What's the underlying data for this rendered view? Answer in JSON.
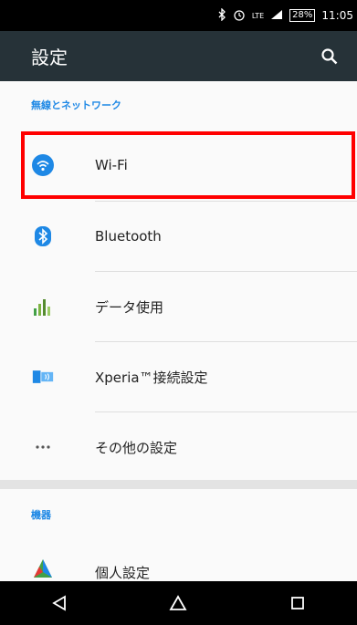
{
  "status_bar": {
    "icons": [
      "bluetooth-icon",
      "alarm-icon",
      "lte-signal-icon",
      "battery-icon"
    ],
    "lte": "LTE",
    "battery": "28%",
    "time": "11:05"
  },
  "app_bar": {
    "title": "設定",
    "icon": "search-icon"
  },
  "sections": [
    {
      "header": "無線とネットワーク",
      "items": [
        {
          "label": "Wi-Fi",
          "icon": "wifi-icon"
        },
        {
          "label": "Bluetooth",
          "icon": "bluetooth-icon"
        },
        {
          "label": "データ使用",
          "icon": "data-usage-icon"
        },
        {
          "label": "Xperia™接続設定",
          "icon": "xperia-connectivity-icon"
        },
        {
          "label": "その他の設定",
          "icon": "more-icon"
        }
      ]
    },
    {
      "header": "機器",
      "items": [
        {
          "label": "個人設定",
          "icon": "personalization-icon"
        }
      ]
    }
  ],
  "nav_bar": {
    "buttons": [
      "back-icon",
      "home-icon",
      "recents-icon"
    ]
  },
  "colors": {
    "app_bar": "#263238",
    "accent": "#1e88e5",
    "highlight": "#ff0000"
  }
}
